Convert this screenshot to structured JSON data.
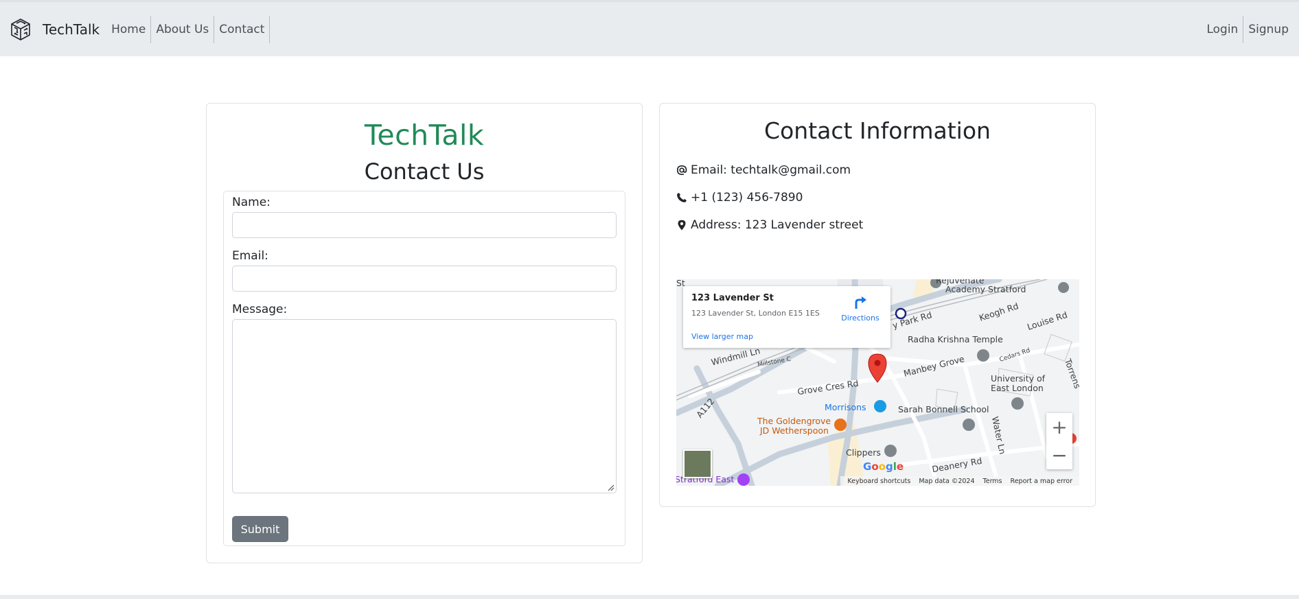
{
  "nav": {
    "brand": "TechTalk",
    "links": [
      "Home",
      "About Us",
      "Contact"
    ],
    "right_links": [
      "Login",
      "Signup"
    ]
  },
  "form": {
    "brand_title": "TechTalk",
    "title": "Contact Us",
    "name_label": "Name:",
    "email_label": "Email:",
    "message_label": "Message:",
    "submit_label": "Submit"
  },
  "info": {
    "title": "Contact Information",
    "email": "Email: techtalk@gmail.com",
    "phone": "+1 (123) 456-7890",
    "address": "Address: 123 Lavender street"
  },
  "map": {
    "place_title": "123 Lavender St",
    "place_address": "123 Lavender St, London E15 1ES",
    "directions": "Directions",
    "larger_map": "View larger map",
    "labels": {
      "rejuvenate": "Rejuvenate",
      "academy": "Academy Stratford",
      "keogh": "Keogh Rd",
      "louise": "Louise Rd",
      "park": "y Park Rd",
      "radha": "Radha Krishna Temple",
      "windmill": "Windmill Ln",
      "millstone": "Millstone C",
      "cedars": "Cedars Rd",
      "manbey": "Manbey Grove",
      "torrens": "Torrens",
      "uel1": "University of",
      "uel2": "East London",
      "grove": "Grove Cres Rd",
      "a112": "A112",
      "morrisons": "Morrisons",
      "sarah": "Sarah Bonnell School",
      "golden1": "The Goldengrove",
      "golden2": "JD Wetherspoon",
      "water": "Water Ln",
      "clippers": "Clippers",
      "deanery": "Deanery Rd",
      "stratford_east": "Stratford East",
      "st": "St"
    },
    "google": "Google",
    "footer": [
      "Keyboard shortcuts",
      "Map data ©2024",
      "Terms",
      "Report a map error"
    ]
  },
  "colors": {
    "brand_green": "#218a57",
    "navbar_bg": "#e9ecef",
    "submit_bg": "#6c757d",
    "map_link": "#1a73e8"
  }
}
